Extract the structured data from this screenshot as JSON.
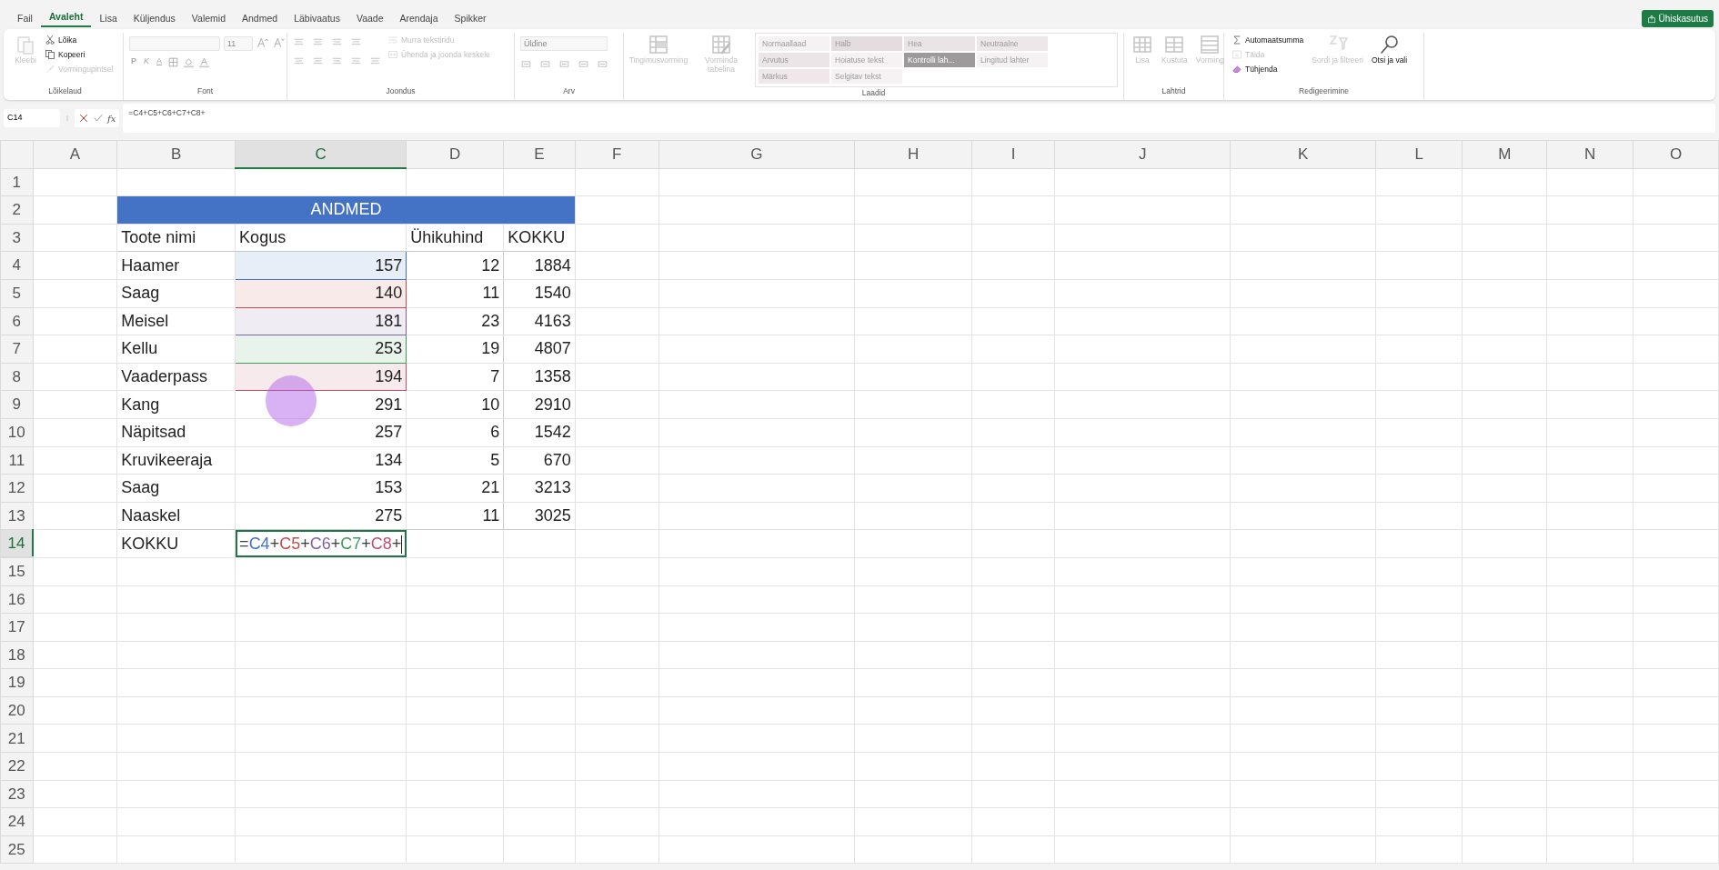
{
  "menu_tabs": [
    {
      "label": "Fail",
      "selected": false
    },
    {
      "label": "Avaleht",
      "selected": true
    },
    {
      "label": "Lisa",
      "selected": false
    },
    {
      "label": "Küljendus",
      "selected": false
    },
    {
      "label": "Valemid",
      "selected": false
    },
    {
      "label": "Andmed",
      "selected": false
    },
    {
      "label": "Läbivaatus",
      "selected": false
    },
    {
      "label": "Vaade",
      "selected": false
    },
    {
      "label": "Arendaja",
      "selected": false
    },
    {
      "label": "Spikker",
      "selected": false
    }
  ],
  "share_button": {
    "label": "Ühiskasutus"
  },
  "ribbon": {
    "groups": [
      {
        "label": "Lõikelaud",
        "items": [
          {
            "kind": "large",
            "label": "Kleebi",
            "disabled": true
          },
          {
            "kind": "stack",
            "items": [
              {
                "label": "Lõika",
                "disabled": false
              },
              {
                "label": "Kopeeri",
                "disabled": false
              },
              {
                "label": "Vormingupintsel",
                "disabled": true
              }
            ]
          }
        ]
      },
      {
        "label": "Font",
        "items": [
          {
            "kind": "font",
            "size": "11",
            "buttons": [
              "P",
              "K",
              "A"
            ]
          }
        ]
      },
      {
        "label": "Joondus",
        "items": [
          {
            "kind": "align"
          },
          {
            "kind": "stack",
            "items": [
              {
                "label": "Murra tekstiridu",
                "disabled": true
              },
              {
                "label": "Ühenda ja joonda keskele",
                "disabled": true
              }
            ]
          }
        ]
      },
      {
        "label": "Arv",
        "items": [
          {
            "kind": "number",
            "value": "Üldine"
          }
        ]
      },
      {
        "label": "Laadid",
        "items": [
          {
            "kind": "large",
            "label": "Tingimusvorming",
            "disabled": true
          },
          {
            "kind": "large",
            "label": "Vorminda tabelina",
            "disabled": true
          },
          {
            "kind": "gallery",
            "styles": [
              {
                "label": "Normaallaad",
                "color": "#f4f2f3"
              },
              {
                "label": "Halb",
                "color": "#e4dcde"
              },
              {
                "label": "Hea",
                "color": "#ebe4e6"
              },
              {
                "label": "Neutraalne",
                "color": "#ede7ea"
              },
              {
                "label": "Arvutus",
                "color": "#ebe5e8"
              },
              {
                "label": "Hoiatuse tekst",
                "color": "#f6f2f4"
              },
              {
                "label": "Kontrolli lah...",
                "color": "#9c9a9b"
              },
              {
                "label": "Lingitud lahter",
                "color": "#f6f2f4"
              },
              {
                "label": "Märkus",
                "color": "#efe7ea"
              },
              {
                "label": "Selgitav tekst",
                "color": "#f6f2f4"
              }
            ]
          }
        ]
      },
      {
        "label": "Lahtrid",
        "items": [
          {
            "kind": "large",
            "label": "Lisa",
            "disabled": true
          },
          {
            "kind": "large",
            "label": "Kustuta",
            "disabled": true
          },
          {
            "kind": "large",
            "label": "Vorming",
            "disabled": true
          }
        ]
      },
      {
        "label": "Redigeerimine",
        "items": [
          {
            "kind": "stack",
            "items": [
              {
                "label": "Automaatsumma",
                "disabled": false
              },
              {
                "label": "Täida",
                "disabled": true
              },
              {
                "label": "Tühjenda",
                "disabled": false
              }
            ]
          },
          {
            "kind": "large",
            "label": "Sordi ja filtreeri",
            "disabled": true
          },
          {
            "kind": "large",
            "label": "Otsi ja vali",
            "disabled": false
          }
        ]
      }
    ]
  },
  "formula_bar": {
    "name_box": "C14",
    "function_button": "fx",
    "formula": "=C4+C5+C6+C7+C8+"
  },
  "sheet": {
    "columns": [
      {
        "label": "A",
        "selected": false
      },
      {
        "label": "B",
        "selected": false
      },
      {
        "label": "C",
        "selected": true
      },
      {
        "label": "D",
        "selected": false
      },
      {
        "label": "E",
        "selected": false
      },
      {
        "label": "F",
        "selected": false
      },
      {
        "label": "G",
        "selected": false
      },
      {
        "label": "H",
        "selected": false
      },
      {
        "label": "I",
        "selected": false
      },
      {
        "label": "J",
        "selected": false
      },
      {
        "label": "K",
        "selected": false
      },
      {
        "label": "L",
        "selected": false
      },
      {
        "label": "M",
        "selected": false
      },
      {
        "label": "N",
        "selected": false
      },
      {
        "label": "O",
        "selected": false
      }
    ],
    "rows": [
      {
        "label": "1",
        "selected": false
      },
      {
        "label": "2",
        "selected": false
      },
      {
        "label": "3",
        "selected": false
      },
      {
        "label": "4",
        "selected": false
      },
      {
        "label": "5",
        "selected": false
      },
      {
        "label": "6",
        "selected": false
      },
      {
        "label": "7",
        "selected": false
      },
      {
        "label": "8",
        "selected": false
      },
      {
        "label": "9",
        "selected": false
      },
      {
        "label": "10",
        "selected": false
      },
      {
        "label": "11",
        "selected": false
      },
      {
        "label": "12",
        "selected": false
      },
      {
        "label": "13",
        "selected": false
      },
      {
        "label": "14",
        "selected": true
      },
      {
        "label": "15",
        "selected": false
      },
      {
        "label": "16",
        "selected": false
      },
      {
        "label": "17",
        "selected": false
      },
      {
        "label": "18",
        "selected": false
      },
      {
        "label": "19",
        "selected": false
      },
      {
        "label": "20",
        "selected": false
      },
      {
        "label": "21",
        "selected": false
      },
      {
        "label": "22",
        "selected": false
      },
      {
        "label": "23",
        "selected": false
      },
      {
        "label": "24",
        "selected": false
      },
      {
        "label": "25",
        "selected": false
      }
    ]
  },
  "data_table": {
    "title": "ANDMED",
    "headers": [
      "Toote nimi",
      "Kogus",
      "Ühikuhind",
      "KOKKU"
    ],
    "rows": [
      {
        "cells": [
          "Haamer",
          "157",
          "12",
          "1884"
        ],
        "color": "#4472c4"
      },
      {
        "cells": [
          "Saag",
          "140",
          "11",
          "1540"
        ],
        "color": "#c0504d"
      },
      {
        "cells": [
          "Meisel",
          "181",
          "23",
          "4163"
        ],
        "color": "#8064a2"
      },
      {
        "cells": [
          "Kellu",
          "253",
          "19",
          "4807"
        ],
        "color": "#3f9a5c"
      },
      {
        "cells": [
          "Vaaderpass",
          "194",
          "7",
          "1358"
        ],
        "color": "#c0506f"
      },
      {
        "cells": [
          "Kang",
          "291",
          "10",
          "2910"
        ]
      },
      {
        "cells": [
          "Näpitsad",
          "257",
          "6",
          "1542"
        ]
      },
      {
        "cells": [
          "Kruvikeeraja",
          "134",
          "5",
          "670"
        ]
      },
      {
        "cells": [
          "Saag",
          "153",
          "21",
          "3213"
        ]
      },
      {
        "cells": [
          "Naaskel",
          "275",
          "11",
          "3025"
        ]
      }
    ],
    "total_row": {
      "label": "KOKKU",
      "formula_tokens": [
        {
          "text": "=",
          "color": "#404040"
        },
        {
          "text": "C4",
          "color": "#4472c4"
        },
        {
          "text": "+",
          "color": "#404040"
        },
        {
          "text": "C5",
          "color": "#c0504d"
        },
        {
          "text": "+",
          "color": "#404040"
        },
        {
          "text": "C6",
          "color": "#8064a2"
        },
        {
          "text": "+",
          "color": "#404040"
        },
        {
          "text": "C7",
          "color": "#3f9a5c"
        },
        {
          "text": "+",
          "color": "#404040"
        },
        {
          "text": "C8",
          "color": "#c0506f"
        },
        {
          "text": "+",
          "color": "#404040"
        }
      ]
    }
  }
}
